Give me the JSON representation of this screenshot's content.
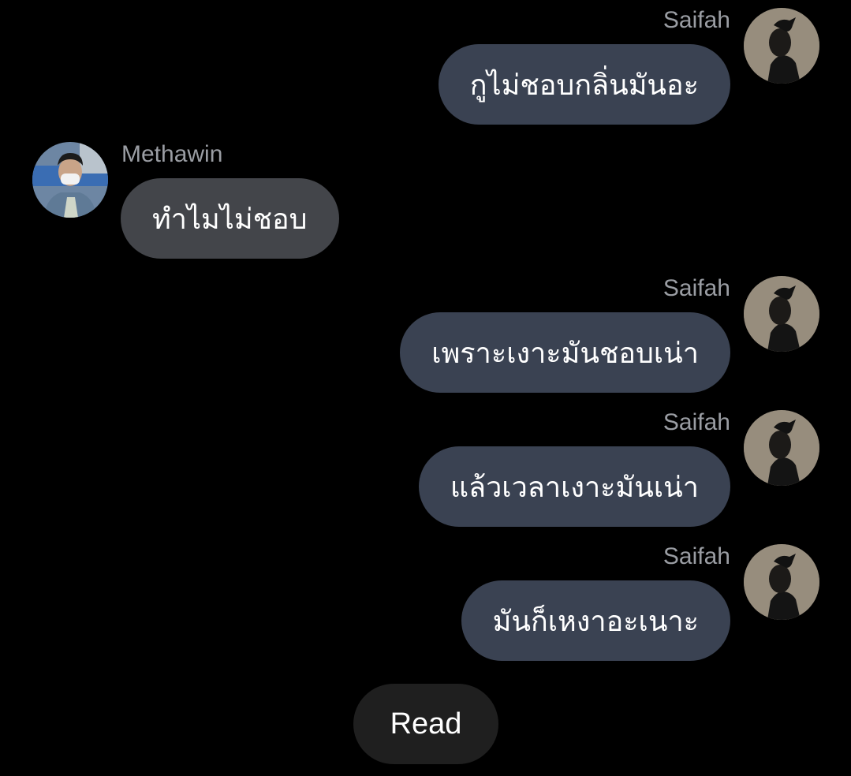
{
  "messages": [
    {
      "sender": "Saifah",
      "text": "กูไม่ชอบกลิ่นมันอะ",
      "direction": "out"
    },
    {
      "sender": "Methawin",
      "text": "ทำไมไม่ชอบ",
      "direction": "in"
    },
    {
      "sender": "Saifah",
      "text": "เพราะเงาะมันชอบเน่า",
      "direction": "out"
    },
    {
      "sender": "Saifah",
      "text": "แล้วเวลาเงาะมันเน่า",
      "direction": "out"
    },
    {
      "sender": "Saifah",
      "text": "มันก็เหงาอะเนาะ",
      "direction": "out"
    }
  ],
  "status": {
    "read_label": "Read"
  },
  "colors": {
    "background": "#000000",
    "outgoing_bubble": "#3a4252",
    "incoming_bubble": "#43454a",
    "sender_name": "#9a9da3",
    "read_pill": "#1f1f1f"
  }
}
